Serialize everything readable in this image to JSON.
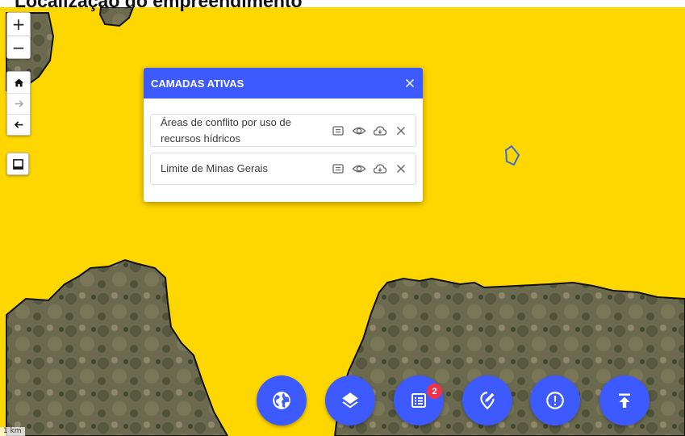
{
  "page": {
    "title": "Localização do empreendimento"
  },
  "map_controls": {
    "zoom_in": "+",
    "zoom_out": "−",
    "icons": [
      "home-icon",
      "arrow-right-icon",
      "arrow-left-icon",
      "legend-icon"
    ]
  },
  "layers_panel": {
    "title": "CAMADAS ATIVAS",
    "layers": [
      {
        "name": "Áreas de conflito por uso de recursos hídricos"
      },
      {
        "name": "Limite de Minas Gerais"
      }
    ],
    "action_icons": [
      "legend-icon",
      "eye-icon",
      "cloud-download-icon",
      "close-icon"
    ]
  },
  "scale": {
    "label": "1 km"
  },
  "toolbar": {
    "buttons": [
      "globe-icon",
      "layers-icon",
      "list-icon",
      "edit-location-icon",
      "alert-icon",
      "upload-icon"
    ],
    "list_badge": "2"
  },
  "colors": {
    "accent": "#3d5afe",
    "map_fill": "#ffd700",
    "badge": "#f0314c"
  }
}
